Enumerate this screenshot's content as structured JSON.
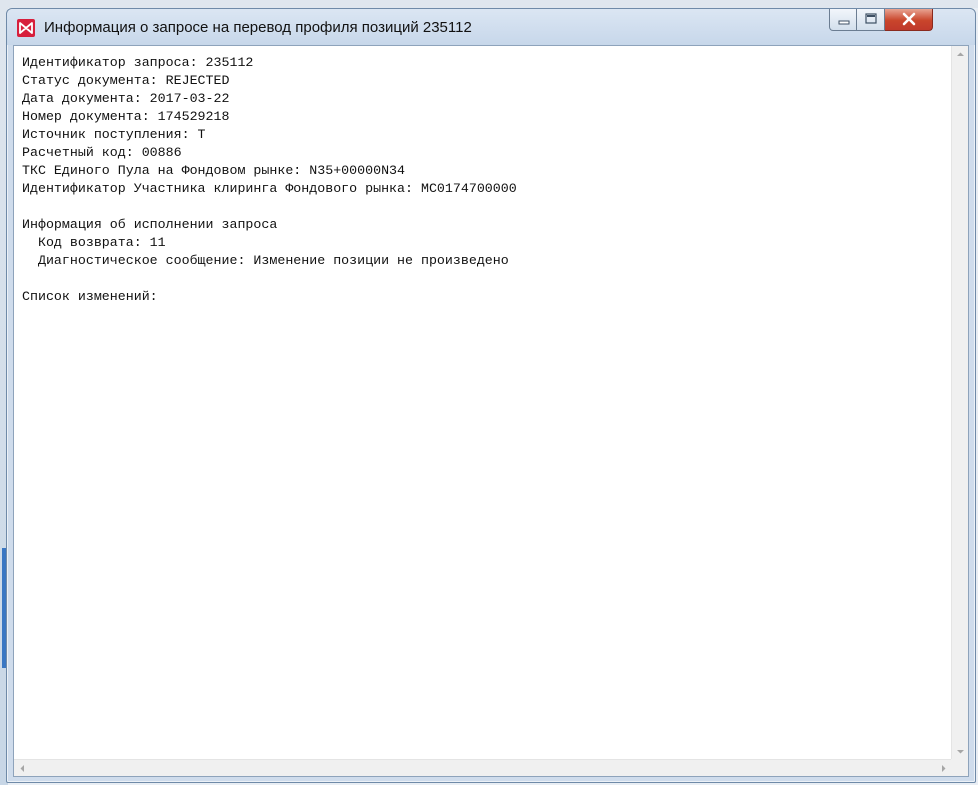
{
  "window": {
    "title": "Информация о запросе на перевод профиля позиций 235112"
  },
  "colors": {
    "app_icon": "#d71f3c",
    "close_button": "#c9452b"
  },
  "content": {
    "lines": [
      "Идентификатор запроса: 235112",
      "Статус документа: REJECTED",
      "Дата документа: 2017-03-22",
      "Номер документа: 174529218",
      "Источник поступления: T",
      "Расчетный код: 00886",
      "ТКС Единого Пула на Фондовом рынке: N35+00000N34",
      "Идентификатор Участника клиринга Фондового рынка: MC0174700000",
      "",
      "Информация об исполнении запроса",
      "  Код возврата: 11",
      "  Диагностическое сообщение: Изменение позиции не произведено",
      "",
      "Список изменений:"
    ]
  }
}
